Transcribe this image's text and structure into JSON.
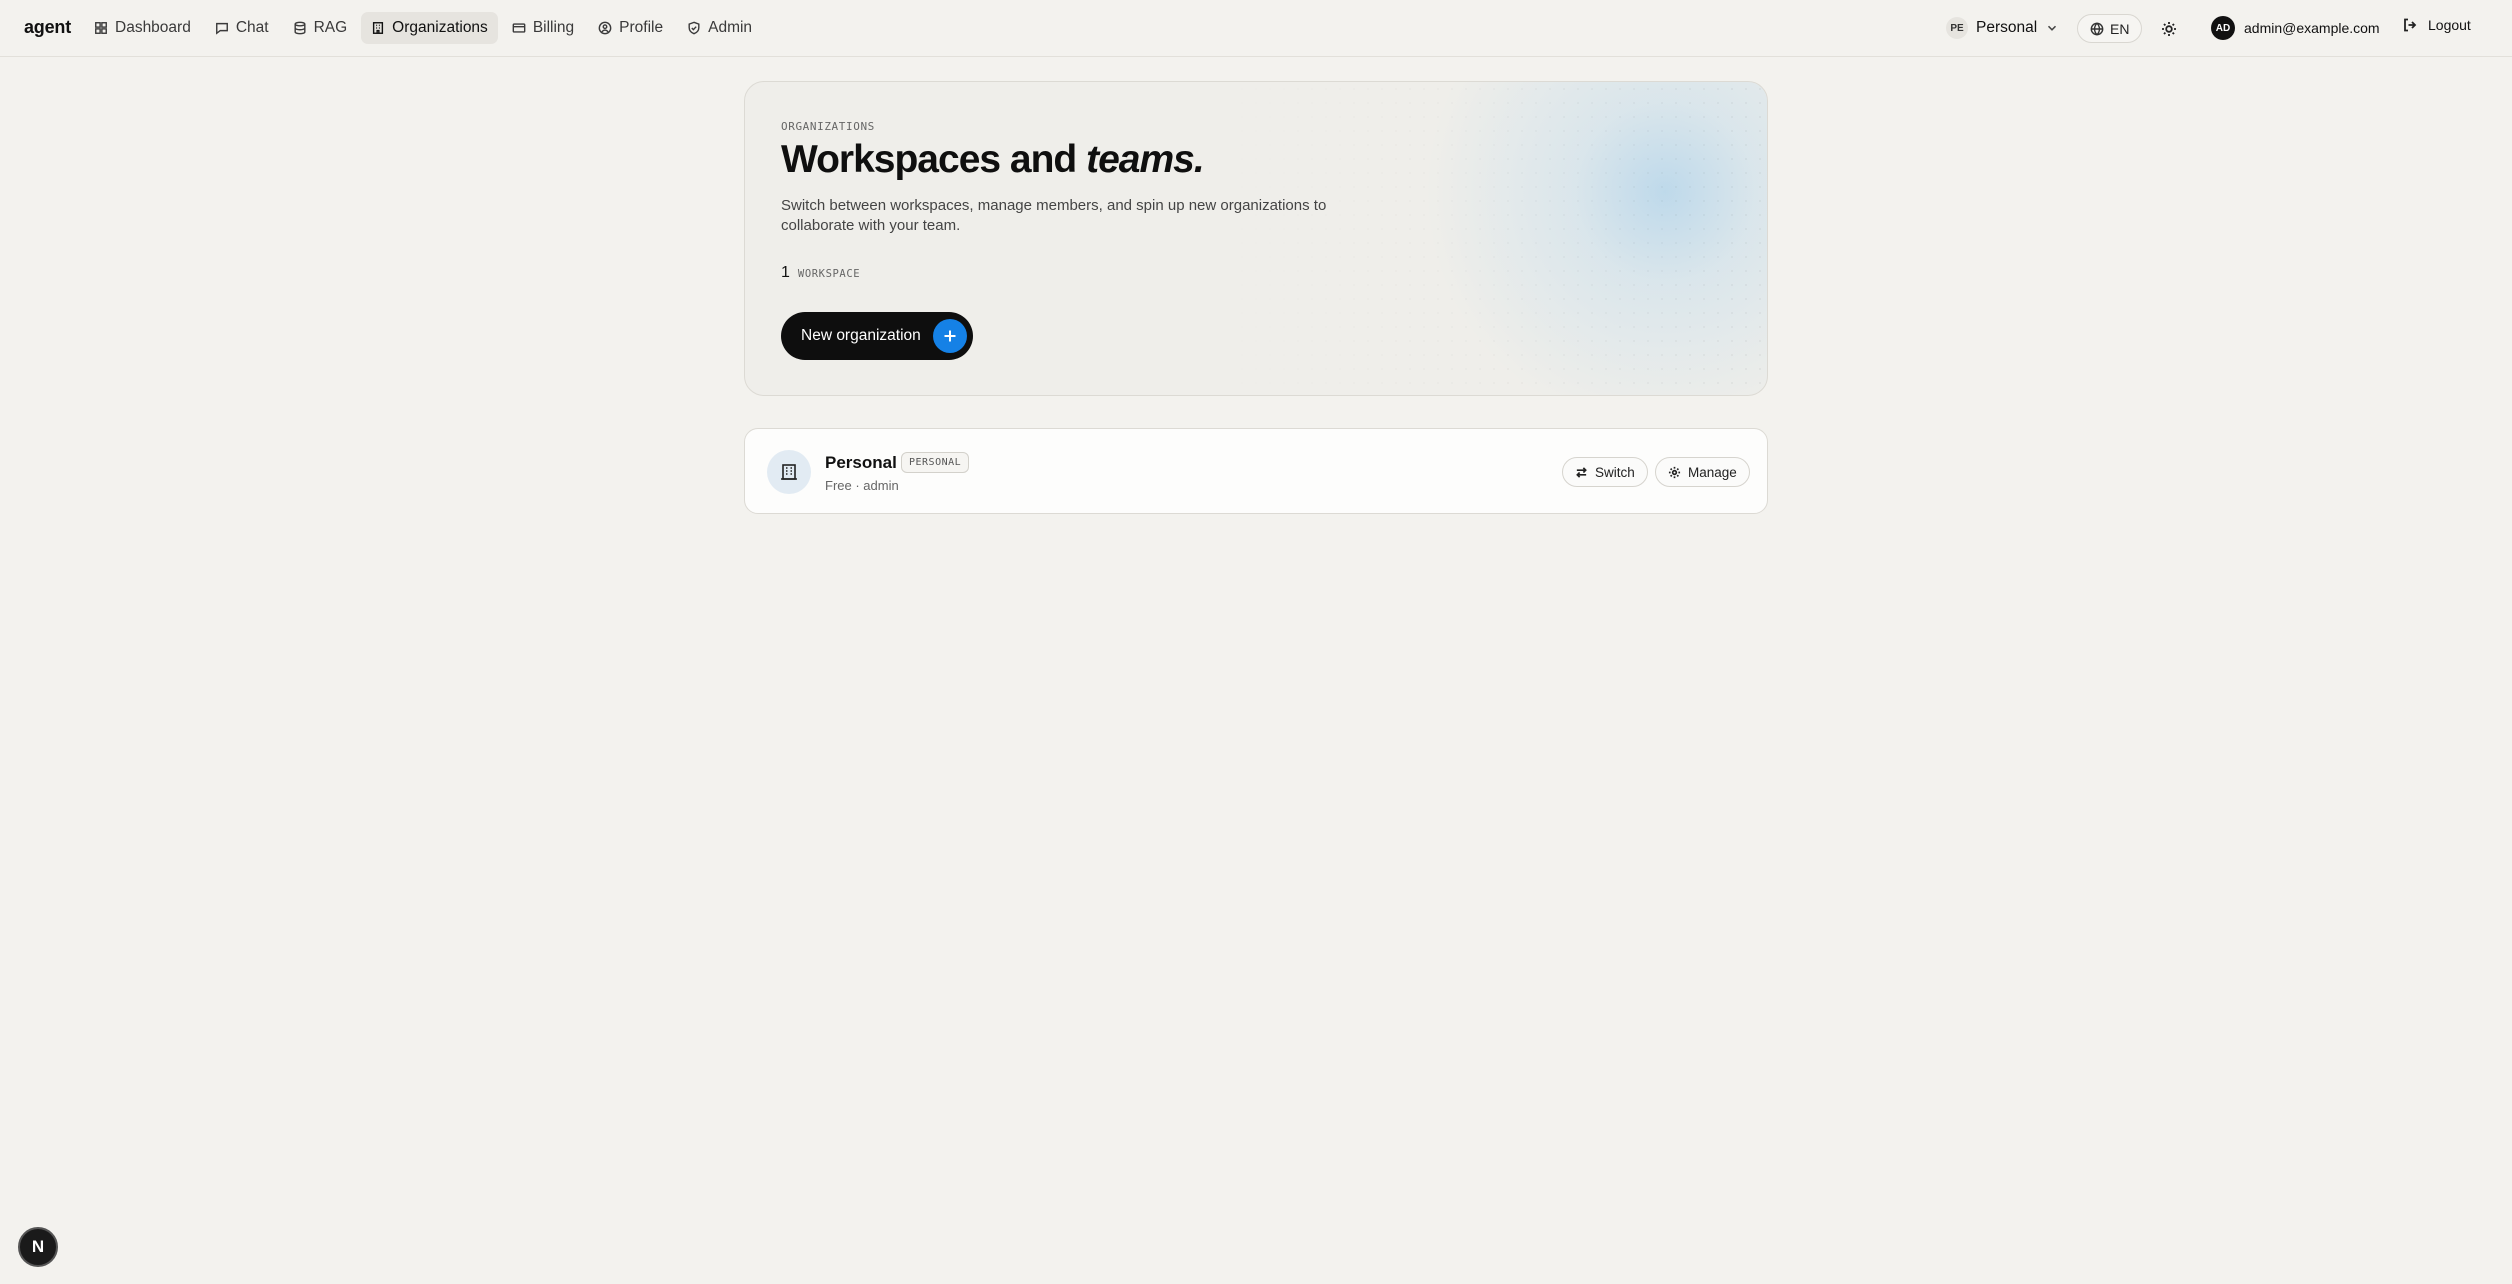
{
  "app": {
    "brand": "agent"
  },
  "nav": {
    "items": [
      {
        "label": "Dashboard",
        "icon": "grid-icon",
        "active": false
      },
      {
        "label": "Chat",
        "icon": "chat-icon",
        "active": false
      },
      {
        "label": "RAG",
        "icon": "database-icon",
        "active": false
      },
      {
        "label": "Organizations",
        "icon": "building-icon",
        "active": true
      },
      {
        "label": "Billing",
        "icon": "credit-card-icon",
        "active": false
      },
      {
        "label": "Profile",
        "icon": "user-circle-icon",
        "active": false
      },
      {
        "label": "Admin",
        "icon": "shield-icon",
        "active": false
      }
    ]
  },
  "header": {
    "workspace_badge": "PE",
    "workspace_name": "Personal",
    "language": "EN",
    "user_initials": "AD",
    "user_email": "admin@example.com",
    "logout_label": "Logout"
  },
  "hero": {
    "eyebrow": "ORGANIZATIONS",
    "title_main": "Workspaces and ",
    "title_em": "teams.",
    "description": "Switch between workspaces, manage members, and spin up new organizations to collaborate with your team.",
    "count": "1",
    "count_label": "WORKSPACE",
    "new_button_label": "New organization"
  },
  "workspaces": [
    {
      "name": "Personal",
      "tag": "PERSONAL",
      "meta": "Free · admin",
      "switch_label": "Switch",
      "manage_label": "Manage"
    }
  ],
  "floating": {
    "badge_letter": "N"
  },
  "colors": {
    "accent": "#1581e6",
    "background": "#f3f2ee",
    "primary_button": "#0e0e0e"
  }
}
